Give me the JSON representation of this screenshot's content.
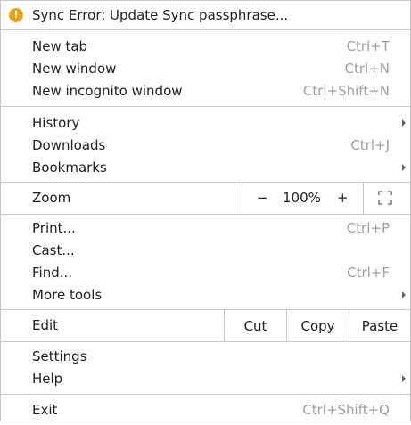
{
  "sync_error": {
    "label": "Sync Error: Update Sync passphrase...",
    "icon": "warning-icon",
    "icon_glyph": "!",
    "icon_color": "#e8a318"
  },
  "tabs_group": [
    {
      "label": "New tab",
      "shortcut": "Ctrl+T"
    },
    {
      "label": "New window",
      "shortcut": "Ctrl+N"
    },
    {
      "label": "New incognito window",
      "shortcut": "Ctrl+Shift+N"
    }
  ],
  "history_group": [
    {
      "label": "History",
      "shortcut": "",
      "submenu": true
    },
    {
      "label": "Downloads",
      "shortcut": "Ctrl+J",
      "submenu": false
    },
    {
      "label": "Bookmarks",
      "shortcut": "",
      "submenu": true
    }
  ],
  "zoom": {
    "label": "Zoom",
    "minus": "−",
    "value": "100%",
    "plus": "+",
    "fullscreen_icon": "fullscreen-icon"
  },
  "tools_group": [
    {
      "label": "Print...",
      "shortcut": "Ctrl+P",
      "submenu": false
    },
    {
      "label": "Cast...",
      "shortcut": "",
      "submenu": false
    },
    {
      "label": "Find...",
      "shortcut": "Ctrl+F",
      "submenu": false
    },
    {
      "label": "More tools",
      "shortcut": "",
      "submenu": true
    }
  ],
  "edit": {
    "label": "Edit",
    "cut": "Cut",
    "copy": "Copy",
    "paste": "Paste"
  },
  "settings_group": [
    {
      "label": "Settings",
      "submenu": false
    },
    {
      "label": "Help",
      "submenu": true
    }
  ],
  "exit": {
    "label": "Exit",
    "shortcut": "Ctrl+Shift+Q"
  }
}
